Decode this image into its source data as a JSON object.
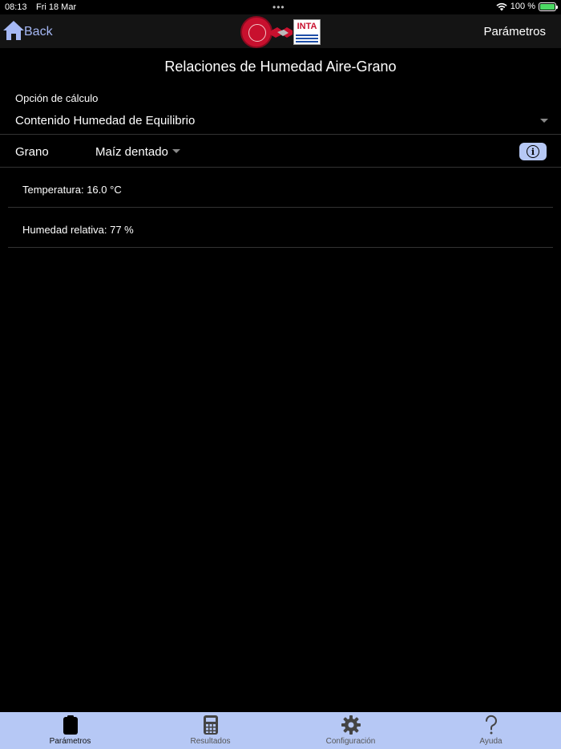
{
  "status": {
    "time": "08:13",
    "date": "Fri 18 Mar",
    "dots": "•••",
    "battery": "100 %"
  },
  "nav": {
    "back_label": "Back",
    "right_label": "Parámetros",
    "logo_text": "INTA"
  },
  "page": {
    "title": "Relaciones de Humedad Aire-Grano"
  },
  "calc": {
    "label": "Opción de cálculo",
    "value": "Contenido Humedad de Equilibrio"
  },
  "grain": {
    "label": "Grano",
    "value": "Maíz dentado"
  },
  "params": {
    "temperature": "Temperatura: 16.0 °C",
    "humidity": "Humedad relativa: 77 %"
  },
  "tabs": [
    {
      "label": "Parámetros",
      "icon": "clipboard-icon",
      "active": true
    },
    {
      "label": "Resultados",
      "icon": "calculator-icon",
      "active": false
    },
    {
      "label": "Configuración",
      "icon": "gear-icon",
      "active": false
    },
    {
      "label": "Ayuda",
      "icon": "question-icon",
      "active": false
    }
  ],
  "colors": {
    "accent": "#a5b8f5",
    "tab_bar": "#b6c8f5",
    "background": "#000000"
  }
}
